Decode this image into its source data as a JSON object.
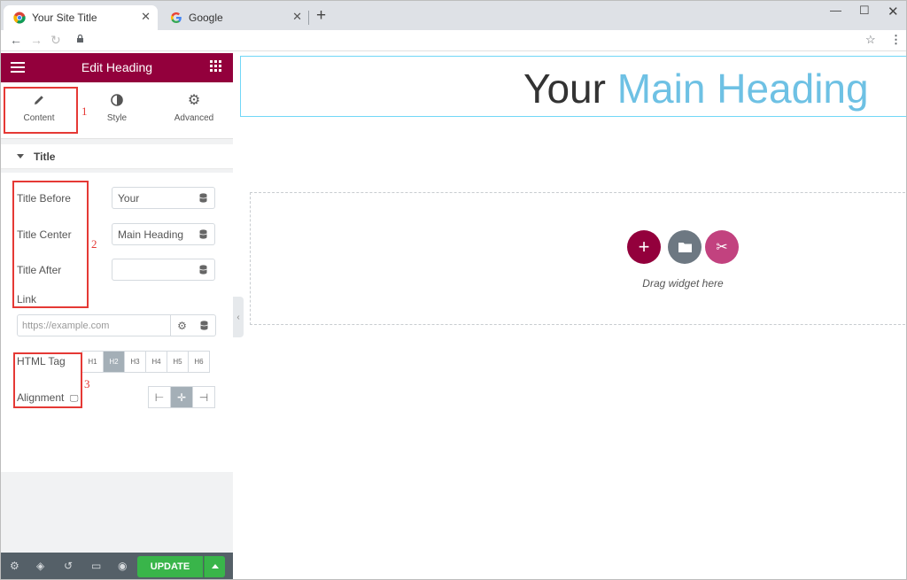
{
  "browser": {
    "tabs": [
      {
        "title": "Your Site Title",
        "active": true
      },
      {
        "title": "Google",
        "active": false
      }
    ]
  },
  "panel": {
    "header_title": "Edit Heading",
    "tabs": [
      {
        "label": "Content",
        "icon": "pencil-icon",
        "active": true
      },
      {
        "label": "Style",
        "icon": "contrast-icon",
        "active": false
      },
      {
        "label": "Advanced",
        "icon": "gear-icon",
        "active": false
      }
    ],
    "section_title": "Title",
    "controls": {
      "title_before_label": "Title Before",
      "title_before_value": "Your",
      "title_center_label": "Title Center",
      "title_center_value": "Main Heading",
      "title_after_label": "Title After",
      "title_after_value": "",
      "link_label": "Link",
      "link_placeholder": "https://example.com",
      "html_tag_label": "HTML Tag",
      "html_tags": [
        "H1",
        "H2",
        "H3",
        "H4",
        "H5",
        "H6"
      ],
      "html_tag_selected": "H2",
      "alignment_label": "Alignment",
      "alignment_selected": "center"
    },
    "footer": {
      "update_label": "UPDATE"
    }
  },
  "annotations": [
    "1",
    "2",
    "3"
  ],
  "preview": {
    "heading_before": "Your",
    "heading_center": "Main Heading",
    "drag_text": "Drag widget here"
  },
  "colors": {
    "brand": "#93003c",
    "heading_accent": "#6ec1e4",
    "update_green": "#39b54a",
    "annotation_red": "#e53935"
  }
}
